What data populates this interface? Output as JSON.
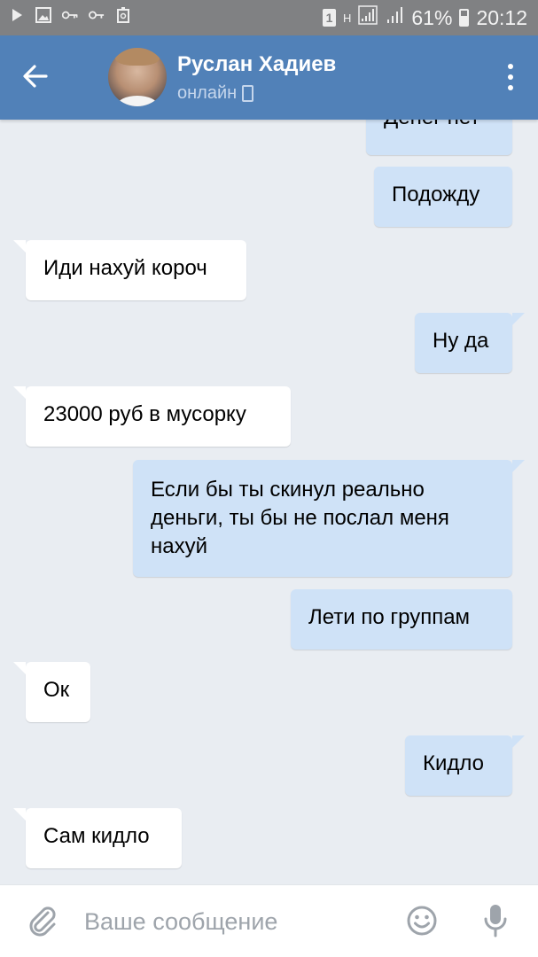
{
  "status_bar": {
    "battery_percent": "61%",
    "time": "20:12",
    "sim_label": "1",
    "network_label": "H",
    "battery_level": 0.61,
    "icons": [
      "play-icon",
      "image-icon",
      "key-icon",
      "key-small-icon",
      "recycle-icon",
      "sim-icon",
      "network-h-icon",
      "signal-icon",
      "signal-icon",
      "battery-icon"
    ]
  },
  "header": {
    "name": "Руслан Хадиев",
    "status": "онлайн",
    "accent_color": "#5181b8"
  },
  "messages": [
    {
      "side": "out",
      "text": "Денег нет"
    },
    {
      "side": "out",
      "text": "Подожду"
    },
    {
      "side": "in",
      "text": "Иди нахуй короч"
    },
    {
      "side": "out",
      "text": "Ну да"
    },
    {
      "side": "in",
      "text": "23000 руб в мусорку"
    },
    {
      "side": "out",
      "text": "Если бы ты скинул реально деньги, ты бы не послал меня нахуй"
    },
    {
      "side": "out",
      "text": "Лети по группам"
    },
    {
      "side": "in",
      "text": "Ок"
    },
    {
      "side": "out",
      "text": "Кидло"
    },
    {
      "side": "in",
      "text": "Сам кидло"
    }
  ],
  "composer": {
    "placeholder": "Ваше сообщение",
    "value": ""
  }
}
